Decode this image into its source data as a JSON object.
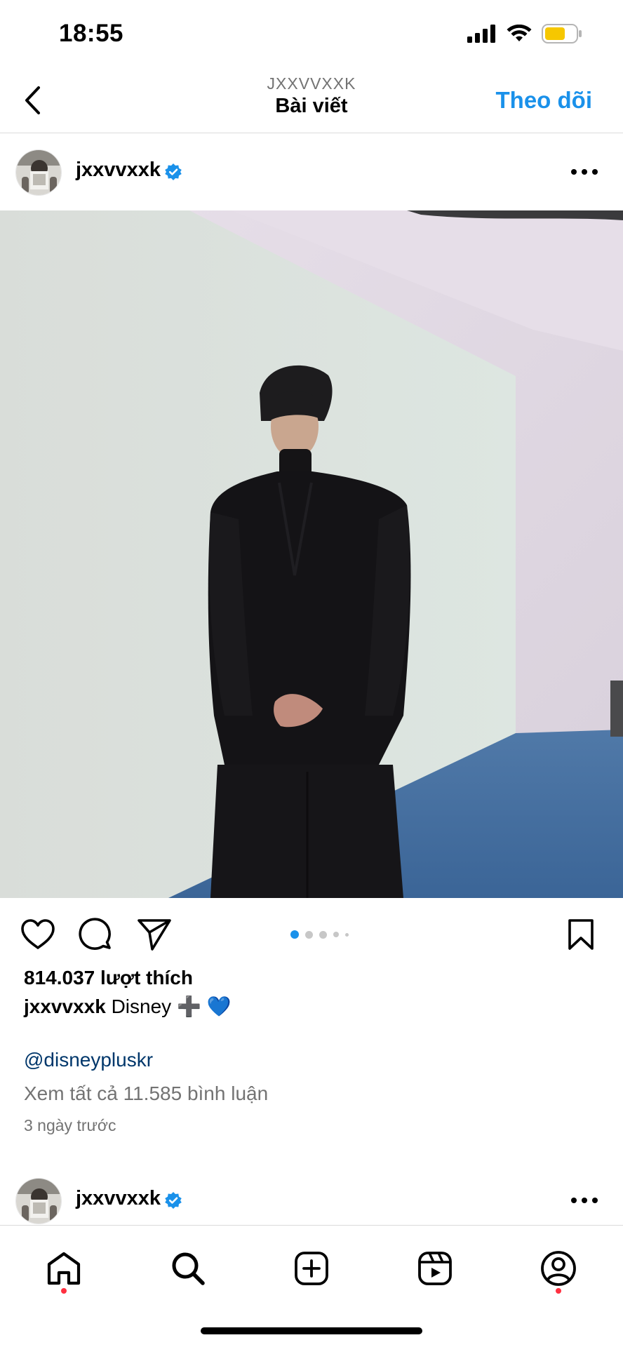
{
  "status_bar": {
    "time": "18:55"
  },
  "header": {
    "subtitle": "JXXVVXXK",
    "title": "Bài viết",
    "follow_label": "Theo dõi"
  },
  "post": {
    "username": "jxxvvxxk",
    "likes": "814.037 lượt thích",
    "caption_user": "jxxvvxxk",
    "caption_text": "Disney ➕ 💙",
    "mention": "@disneypluskr",
    "view_comments": "Xem tất cả 11.585 bình luận",
    "time_ago": "3 ngày trước",
    "carousel": {
      "pages_visible": 5,
      "active_index": 0
    }
  },
  "next_post": {
    "username": "jxxvvxxk"
  },
  "tab_bar": {
    "items": [
      "home-icon",
      "search-icon",
      "create-icon",
      "reels-icon",
      "profile-icon"
    ],
    "active": "home-icon"
  },
  "colors": {
    "accent": "#1a91ea",
    "verified": "#1a91ea",
    "notification": "#ff3040",
    "carousel_active": "#1a91ea"
  }
}
